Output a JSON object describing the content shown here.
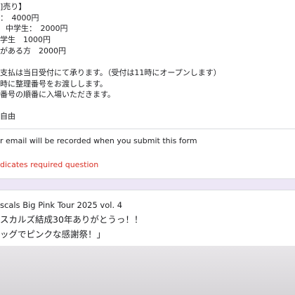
{
  "ticket_card": {
    "lines": [
      "]売り】",
      "：　4000円",
      "中学生：　2000円",
      "学生　1000円",
      "がある方　2000円",
      "支払は当日受付にて承ります。（受付は11時にオープンします）",
      "時に整理番号をお渡しします。",
      "番号の順番に入場いただきます。",
      "自由"
    ]
  },
  "email_notice": "r email will be recorded when you submit this form",
  "required_notice": "dicates required question",
  "title_card": {
    "line1": "scals Big Pink Tour 2025 vol. 4",
    "line2": "スカルズ結成30年ありがとうっ！！",
    "line3": "ッグでピンクな感謝祭！」"
  }
}
